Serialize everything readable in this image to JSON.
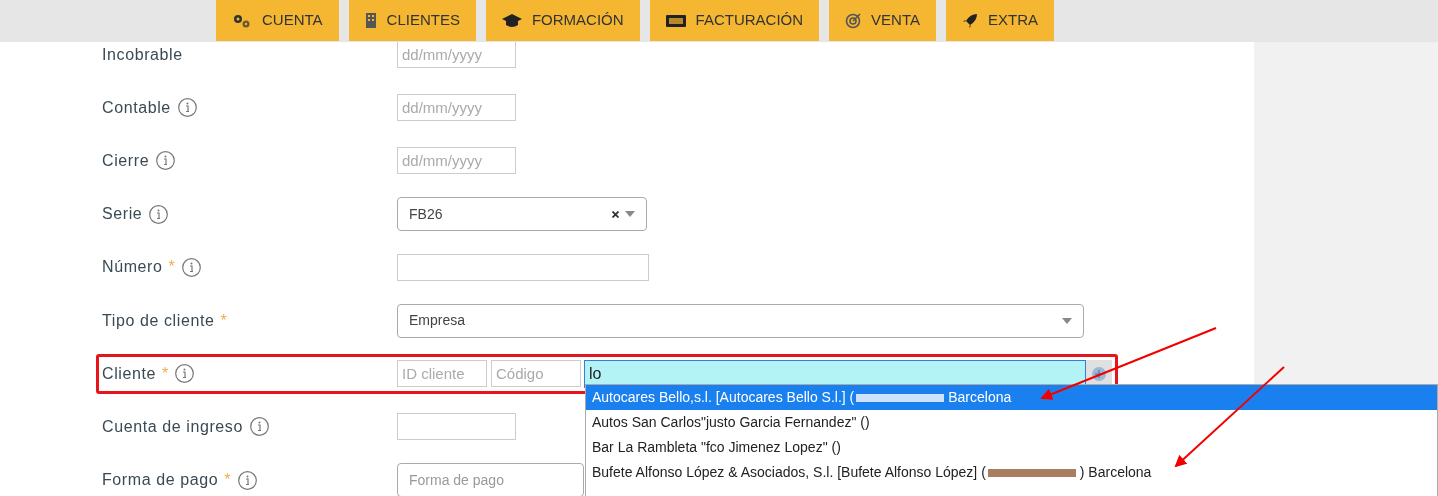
{
  "tabs": [
    {
      "label": "CUENTA"
    },
    {
      "label": "CLIENTES"
    },
    {
      "label": "FORMACIÓN"
    },
    {
      "label": "FACTURACIÓN"
    },
    {
      "label": "VENTA"
    },
    {
      "label": "EXTRA"
    }
  ],
  "fields": [
    {
      "kind": "date",
      "label": "Incobrable",
      "info": false,
      "placeholder": "dd/mm/yyyy"
    },
    {
      "kind": "date",
      "label": "Contable",
      "info": true,
      "placeholder": "dd/mm/yyyy"
    },
    {
      "kind": "date",
      "label": "Cierre",
      "info": true,
      "placeholder": "dd/mm/yyyy"
    },
    {
      "kind": "select",
      "label": "Serie",
      "info": true,
      "value": "FB26",
      "clearable": true,
      "caret": true
    },
    {
      "kind": "text",
      "label": "Número",
      "required_mark": "*",
      "info": true
    },
    {
      "kind": "select",
      "label": "Tipo de cliente",
      "required_mark": "*",
      "info": false,
      "value": "Empresa",
      "clearable": false,
      "caret": true
    },
    {
      "kind": "client",
      "label": "Cliente",
      "required_mark": "*",
      "info": true,
      "highlighted": true,
      "id_placeholder": "ID cliente",
      "code_placeholder": "Código",
      "value": "lo"
    },
    {
      "kind": "text",
      "label": "Cuenta de ingreso",
      "info": true
    },
    {
      "kind": "select",
      "label": "Forma de pago",
      "required_mark": "*",
      "info": true,
      "placeholder": "Forma de pago",
      "clearable": false,
      "caret": false
    }
  ],
  "dropdown": [
    {
      "text": "Autocares Bello,s.l. [Autocares Bello S.l.] (",
      "redacted": true,
      "after": "Barcelona",
      "selected": true
    },
    {
      "text": "Autos San Carlos\"justo Garcia Fernandez\" ()",
      "redacted": false,
      "selected": false
    },
    {
      "text": "Bar La Rambleta \"fco Jimenez Lopez\" ()",
      "redacted": false,
      "selected": false
    },
    {
      "text": "Bufete Alfonso López & Asociados, S.l. [Bufete Alfonso López] (",
      "redacted": true,
      "after": ") Barcelona",
      "selected": false
    }
  ]
}
